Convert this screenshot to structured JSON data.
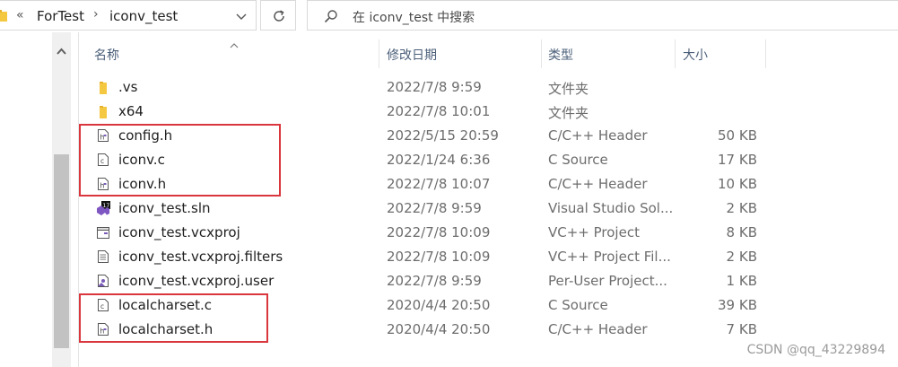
{
  "address": {
    "crumbs": [
      "ForTest",
      "iconv_test"
    ],
    "overflow_label": "«",
    "separator": "›"
  },
  "search": {
    "placeholder": "在 iconv_test 中搜索"
  },
  "columns": {
    "name": "名称",
    "date": "修改日期",
    "type": "类型",
    "size": "大小"
  },
  "files": [
    {
      "name": ".vs",
      "date": "2022/7/8 9:59",
      "type": "文件夹",
      "size": "",
      "icon": "folder-icon"
    },
    {
      "name": "x64",
      "date": "2022/7/8 10:01",
      "type": "文件夹",
      "size": "",
      "icon": "folder-icon"
    },
    {
      "name": "config.h",
      "date": "2022/5/15 20:59",
      "type": "C/C++ Header",
      "size": "50 KB",
      "icon": "header-file-icon"
    },
    {
      "name": "iconv.c",
      "date": "2022/1/24 6:36",
      "type": "C Source",
      "size": "17 KB",
      "icon": "c-source-file-icon"
    },
    {
      "name": "iconv.h",
      "date": "2022/7/8 10:07",
      "type": "C/C++ Header",
      "size": "10 KB",
      "icon": "header-file-icon"
    },
    {
      "name": "iconv_test.sln",
      "date": "2022/7/8 9:59",
      "type": "Visual Studio Sol...",
      "size": "2 KB",
      "icon": "vs-solution-icon"
    },
    {
      "name": "iconv_test.vcxproj",
      "date": "2022/7/8 10:09",
      "type": "VC++ Project",
      "size": "8 KB",
      "icon": "vcxproj-icon"
    },
    {
      "name": "iconv_test.vcxproj.filters",
      "date": "2022/7/8 10:09",
      "type": "VC++ Project Fil...",
      "size": "2 KB",
      "icon": "filters-file-icon"
    },
    {
      "name": "iconv_test.vcxproj.user",
      "date": "2022/7/8 9:59",
      "type": "Per-User Project...",
      "size": "1 KB",
      "icon": "user-file-icon"
    },
    {
      "name": "localcharset.c",
      "date": "2020/4/4 20:50",
      "type": "C Source",
      "size": "39 KB",
      "icon": "c-source-file-icon"
    },
    {
      "name": "localcharset.h",
      "date": "2020/4/4 20:50",
      "type": "C/C++ Header",
      "size": "7 KB",
      "icon": "header-file-icon"
    }
  ],
  "highlight_color": "#d9363e",
  "folder_color": "#f5c842",
  "watermark": "CSDN @qq_43229894"
}
